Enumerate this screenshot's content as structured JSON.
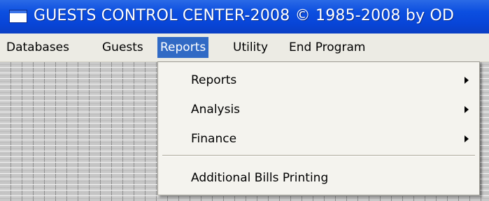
{
  "window": {
    "title": "GUESTS CONTROL CENTER-2008 © 1985-2008 by OD",
    "icon": "app-window-icon"
  },
  "menubar": {
    "items": [
      {
        "label": "Databases"
      },
      {
        "label": "Guests"
      },
      {
        "label": "Reports",
        "active": true
      },
      {
        "label": "Utility"
      },
      {
        "label": "End Program"
      }
    ]
  },
  "reports_menu": {
    "items": [
      {
        "label": "Reports",
        "submenu": true
      },
      {
        "label": "Analysis",
        "submenu": true
      },
      {
        "label": "Finance",
        "submenu": true
      },
      {
        "label": "Additional Bills Printing",
        "submenu": false
      }
    ]
  },
  "colors": {
    "titlebar": "#0c4fe0",
    "menu_highlight": "#316ac5",
    "menubar": "#ecebe4",
    "menu_background": "#f4f3ee"
  }
}
